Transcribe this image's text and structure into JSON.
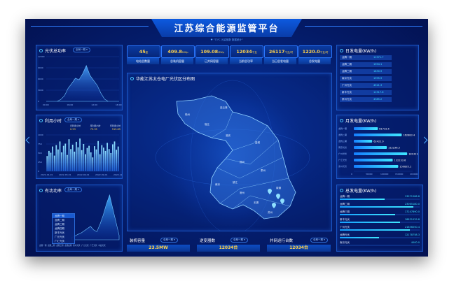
{
  "header": {
    "title": "江苏综合能源监管平台",
    "subtitle": "♥ \"73℃ 污染指数 数据统计\""
  },
  "stats": [
    {
      "value": "45",
      "unit": "座",
      "label": "电站总数量"
    },
    {
      "value": "409.8",
      "unit": "MWp",
      "label": "总装机容量"
    },
    {
      "value": "109.08",
      "unit": "MWp",
      "label": "已并网容量"
    },
    {
      "value": "12034",
      "unit": "千瓦",
      "label": "当前总功率"
    },
    {
      "value": "26117",
      "unit": "千瓦/时",
      "label": "当日总发电量"
    },
    {
      "value": "1220.0",
      "unit": "千瓦/时",
      "label": "总发电量"
    }
  ],
  "left": {
    "power": {
      "title": "光伏总功率",
      "select": "全局一期 ▾"
    },
    "hours": {
      "title": "利用小时",
      "select": "全局一期 ▾",
      "legend": [
        {
          "label": "日利用小时",
          "value": "0.53"
        },
        {
          "label": "月利用小时",
          "value": "75.35"
        },
        {
          "label": "年利用小时",
          "value": "515.85"
        }
      ]
    },
    "active": {
      "title": "有功功率",
      "select": "全局一期 ▾",
      "menu": [
        "龙腾一期",
        "龙腾二期",
        "龙腾三期",
        "龙腾四期",
        "新丰光伏",
        "广元光伏",
        "广汇光伏",
        "丰益光伏"
      ]
    }
  },
  "map": {
    "title": "华能江苏太仓电厂光伏区分布图",
    "cities": [
      "徐州",
      "连云港",
      "宿迁",
      "淮安",
      "盐城",
      "扬州",
      "泰州",
      "南京",
      "镇江",
      "常州",
      "南通",
      "无锡",
      "苏州"
    ]
  },
  "right": {
    "daily": {
      "title": "日发电量(KW/h)",
      "rows": [
        {
          "name": "龙腾一期",
          "value": "11971.7"
        },
        {
          "name": "龙腾二期",
          "value": "1994.1"
        },
        {
          "name": "龙腾三期",
          "value": "1830.9"
        },
        {
          "name": "南京光伏",
          "value": "1995.9"
        },
        {
          "name": "广州光伏",
          "value": "4521.3"
        },
        {
          "name": "新丰光伏",
          "value": "11517.6"
        },
        {
          "name": "泰州光伏",
          "value": "4385.2"
        }
      ]
    },
    "monthly": {
      "title": "月发电量(KW/h)",
      "rows": [
        {
          "name": "龙腾一期",
          "value": "81732.5"
        },
        {
          "name": "龙腾二期",
          "value": "162883.4"
        },
        {
          "name": "龙腾三期",
          "value": "62422.9"
        },
        {
          "name": "南京光伏",
          "value": "112236.5"
        },
        {
          "name": "广州光伏",
          "value": "181321.2"
        },
        {
          "name": "广汇光伏",
          "value": "132233.6"
        },
        {
          "name": "泰州光伏",
          "value": "150835.1"
        }
      ],
      "axis": [
        "0",
        "50000",
        "100000",
        "150000",
        "200000"
      ]
    },
    "total": {
      "title": "总发电量(KW/h)",
      "rows": [
        {
          "name": "龙腾一期",
          "value": "13971586.8"
        },
        {
          "name": "龙腾二期",
          "value": "23065180.0"
        },
        {
          "name": "龙腾三期",
          "value": "17247890.0"
        },
        {
          "name": "新丰光伏",
          "value": "18831029.8"
        },
        {
          "name": "广州光伏",
          "value": "21856050.4"
        },
        {
          "name": "龙腾光伏",
          "value": "12178758.3"
        },
        {
          "name": "南京光伏",
          "value": "4000.0"
        }
      ]
    }
  },
  "bottom": [
    {
      "title": "装机容量",
      "select": "全局一期 ▾",
      "value": "23.5MW"
    },
    {
      "title": "逆变器数",
      "select": "全局一期 ▾",
      "value": "12034台"
    },
    {
      "title": "并网运行台数",
      "select": "全局一期 ▾",
      "value": "12034台"
    }
  ],
  "chart_data": [
    {
      "type": "area",
      "title": "光伏总功率",
      "x": [
        "00:00",
        "06:00",
        "12:00",
        "18:00"
      ],
      "series": [
        {
          "name": "",
          "values": [
            0,
            0,
            0,
            0,
            500,
            1500,
            3500,
            4800,
            6200,
            5800,
            7400,
            9600,
            7000,
            5600,
            4300,
            2200,
            600,
            0,
            0,
            0,
            0
          ]
        }
      ],
      "ylim": [
        0,
        12000
      ]
    },
    {
      "type": "bar",
      "title": "利用小时",
      "categories": [
        "2022-01-01",
        "2022-03-01",
        "2022-06-01",
        "2022-09-01",
        "2022-12-01"
      ],
      "values": [
        420,
        560,
        510,
        680,
        430,
        720,
        600,
        820,
        520,
        700,
        760,
        450,
        880,
        610,
        730,
        540,
        810,
        660,
        900,
        580,
        750,
        470,
        640,
        700,
        520,
        380,
        690,
        600,
        830,
        470,
        720,
        650,
        560,
        780,
        610,
        500,
        740,
        820,
        590,
        680
      ],
      "ylim": [
        0,
        1000
      ]
    },
    {
      "type": "area",
      "title": "有功功率",
      "values": [
        5,
        8,
        12,
        15,
        20,
        25,
        30,
        22,
        18,
        35,
        55,
        80,
        100,
        70,
        40,
        10
      ],
      "ylim": [
        0,
        100
      ]
    }
  ]
}
